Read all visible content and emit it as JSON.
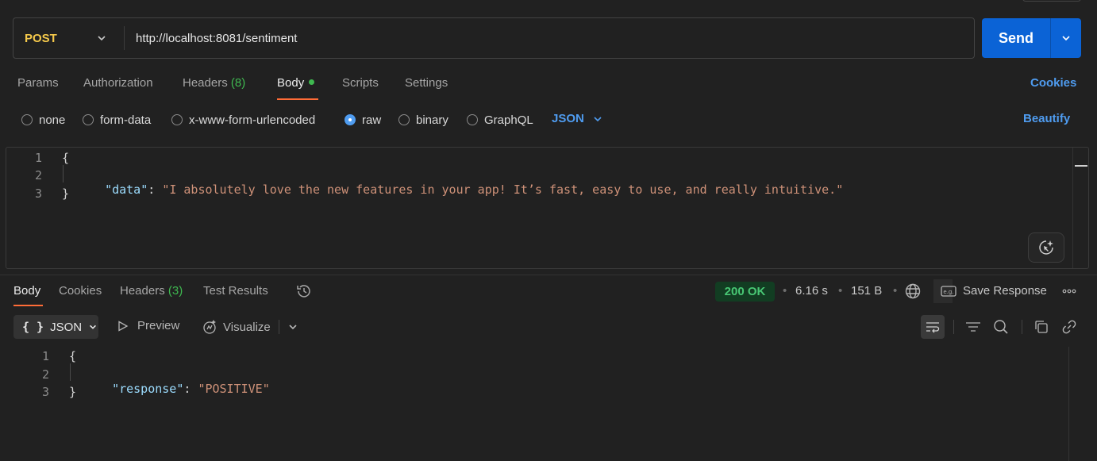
{
  "request": {
    "method": "POST",
    "url": "http://localhost:8081/sentiment",
    "send_label": "Send"
  },
  "request_tabs": {
    "params": "Params",
    "authorization": "Authorization",
    "headers": "Headers",
    "headers_count": "(8)",
    "body": "Body",
    "scripts": "Scripts",
    "settings": "Settings",
    "cookies": "Cookies"
  },
  "body_types": {
    "none": "none",
    "form_data": "form-data",
    "urlencoded": "x-www-form-urlencoded",
    "raw": "raw",
    "binary": "binary",
    "graphql": "GraphQL",
    "selected": "raw",
    "language": "JSON",
    "beautify": "Beautify"
  },
  "request_body": {
    "line_numbers": [
      "1",
      "2",
      "3"
    ],
    "open_brace": "{",
    "key": "\"data\"",
    "colon": ": ",
    "value": "\"I absolutely love the new features in your app! It’s fast, easy to use, and really intuitive.\"",
    "close_brace": "}"
  },
  "response_tabs": {
    "body": "Body",
    "cookies": "Cookies",
    "headers": "Headers",
    "headers_count": "(3)",
    "test_results": "Test Results"
  },
  "response_meta": {
    "status": "200 OK",
    "status_color": "#48c774",
    "time": "6.16 s",
    "size": "151 B",
    "save_response": "Save Response",
    "separator": "•"
  },
  "response_toolbar": {
    "format_icon": "{ }",
    "format": "JSON",
    "preview": "Preview",
    "visualize": "Visualize"
  },
  "response_body": {
    "line_numbers": [
      "1",
      "2",
      "3"
    ],
    "open_brace": "{",
    "key": "\"response\"",
    "colon": ": ",
    "value": "\"POSITIVE\"",
    "close_brace": "}"
  },
  "icons": [
    "chevron-down-icon",
    "history-icon",
    "globe-icon",
    "save-response-icon",
    "more-icon",
    "play-icon",
    "visualize-icon",
    "wrap-lines-icon",
    "filter-icon",
    "search-icon",
    "copy-icon",
    "link-icon",
    "ai-assist-icon"
  ],
  "colors": {
    "accent": "#ff6c37",
    "send": "#0b63d6",
    "method": "#f5c94b",
    "link": "#4f9cf0",
    "json_key": "#9cdcfe",
    "json_string": "#ce9178"
  }
}
